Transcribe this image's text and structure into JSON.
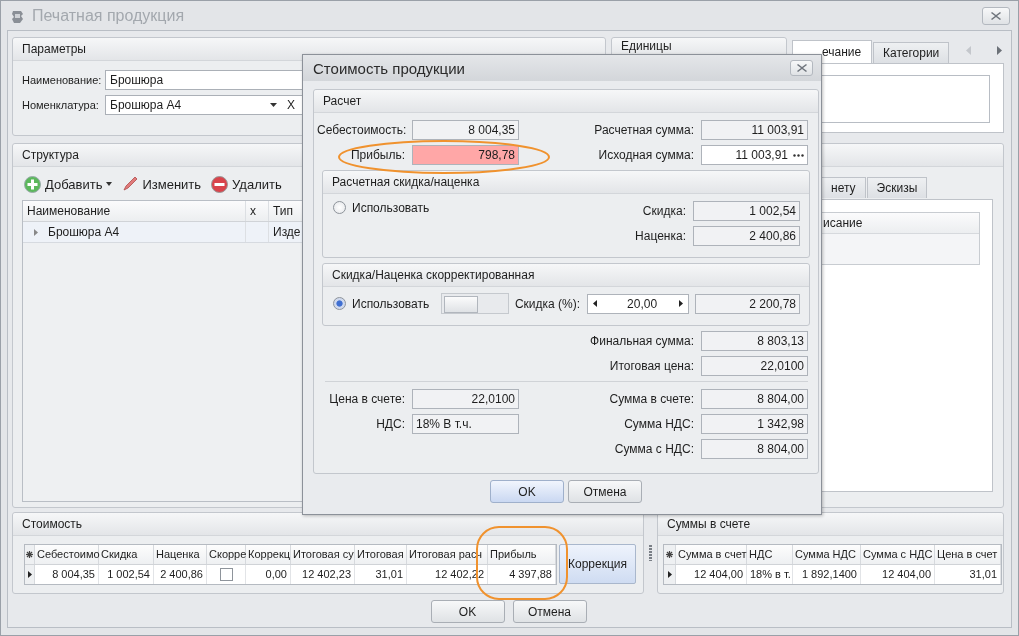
{
  "window": {
    "title": "Печатная продукция",
    "active": false
  },
  "params": {
    "title": "Параметры",
    "fields": [
      {
        "label": "Наименование:",
        "value": "Брошюра",
        "kind": "text"
      },
      {
        "label": "Номенклатура:",
        "value": "Брошюра А4",
        "kind": "combo",
        "clear": "X"
      }
    ]
  },
  "units": {
    "title": "Единицы"
  },
  "notes_tabs": [
    {
      "label": "ечание",
      "selected": true
    },
    {
      "label": "Категории",
      "selected": false
    }
  ],
  "structure": {
    "title": "Структура",
    "toolbar": [
      {
        "label": "Добавить",
        "kind": "add",
        "dropdown": true
      },
      {
        "label": "Изменить",
        "kind": "edit",
        "dropdown": false
      },
      {
        "label": "Удалить",
        "kind": "delete",
        "dropdown": false
      }
    ],
    "columns": [
      "Наименование",
      "x",
      "Тип"
    ],
    "rows": [
      {
        "cells": [
          "Брошюра А4",
          "",
          "Изде"
        ],
        "expanded": false
      }
    ]
  },
  "detail_tabs": [
    {
      "label": "нету",
      "selected": false
    },
    {
      "label": "Эскизы",
      "selected": false
    }
  ],
  "detail_columns": [
    "исание"
  ],
  "cost": {
    "title": "Стоимость",
    "columns": [
      {
        "label": "Себестоимо",
        "kind": "number"
      },
      {
        "label": "Скидка",
        "kind": "number"
      },
      {
        "label": "Наценка",
        "kind": "number"
      },
      {
        "label": "Скорре",
        "kind": "check"
      },
      {
        "label": "Коррекц",
        "kind": "number"
      },
      {
        "label": "Итоговая су",
        "kind": "number"
      },
      {
        "label": "Итоговая",
        "kind": "number"
      },
      {
        "label": "Итоговая расч",
        "kind": "number"
      },
      {
        "label": "Прибыль",
        "kind": "number"
      }
    ],
    "rows": [
      {
        "cells": [
          {
            "value": "8 004,35"
          },
          {
            "value": "1 002,54"
          },
          {
            "value": "2 400,86"
          },
          {
            "checked": false
          },
          {
            "value": "0,00"
          },
          {
            "value": "12 402,23"
          },
          {
            "value": "31,01"
          },
          {
            "value": "12 402,22"
          },
          {
            "value": "4 397,88"
          }
        ]
      }
    ],
    "button": "Коррекция"
  },
  "invoice": {
    "title": "Суммы в счете",
    "columns": [
      {
        "label": "Сумма в счет",
        "kind": "number"
      },
      {
        "label": "НДС",
        "kind": "text"
      },
      {
        "label": "Сумма НДС",
        "kind": "number"
      },
      {
        "label": "Сумма с НДС",
        "kind": "number"
      },
      {
        "label": "Цена в счет",
        "kind": "number"
      }
    ],
    "rows": [
      {
        "cells": [
          {
            "value": "12 404,00"
          },
          {
            "value": "18% в т."
          },
          {
            "value": "1 892,1400"
          },
          {
            "value": "12 404,00"
          },
          {
            "value": "31,01"
          }
        ]
      }
    ]
  },
  "buttons": [
    {
      "label": "OK"
    },
    {
      "label": "Отмена"
    }
  ],
  "dialog": {
    "title": "Стоимость продукции",
    "group_title": "Расчет",
    "top": [
      {
        "left": {
          "label": "Себестоимость:",
          "value": "8 004,35",
          "kind": "readonly"
        },
        "right": {
          "label": "Расчетная сумма:",
          "value": "11 003,91",
          "kind": "readonly"
        }
      },
      {
        "left": {
          "label": "Прибыль:",
          "value": "798,78",
          "kind": "warning"
        },
        "right": {
          "label": "Исходная сумма:",
          "value": "11 003,91",
          "kind": "picker"
        }
      }
    ],
    "calc_group": {
      "title": "Расчетная скидка/наценка",
      "option": {
        "label": "Использовать",
        "selected": false
      },
      "fields": [
        {
          "label": "Скидка:",
          "value": "1 002,54",
          "kind": "readonly"
        },
        {
          "label": "Наценка:",
          "value": "2 400,86",
          "kind": "readonly"
        }
      ]
    },
    "adjusted_group": {
      "title": "Скидка/Наценка скорректированная",
      "option": {
        "label": "Использовать",
        "selected": true
      },
      "switch_on": false,
      "percent": {
        "label": "Скидка (%):",
        "value": "20,00"
      },
      "amount": "2 200,78"
    },
    "totals": [
      {
        "label": "Финальная сумма:",
        "value": "8 803,13",
        "kind": "readonly"
      },
      {
        "label": "Итоговая цена:",
        "value": "22,0100",
        "kind": "readonly"
      }
    ],
    "invoice_left": [
      {
        "label": "Цена в счете:",
        "value": "22,0100",
        "kind": "readonly"
      },
      {
        "label": "НДС:",
        "value": "18% В т.ч.",
        "kind": "text"
      }
    ],
    "invoice_right": [
      {
        "label": "Сумма в счете:",
        "value": "8 804,00",
        "kind": "readonly"
      },
      {
        "label": "Сумма НДС:",
        "value": "1 342,98",
        "kind": "readonly"
      },
      {
        "label": "Сумма с НДС:",
        "value": "8 804,00",
        "kind": "readonly"
      }
    ],
    "buttons": [
      {
        "label": "OK",
        "default": true
      },
      {
        "label": "Отмена",
        "default": false
      }
    ]
  }
}
